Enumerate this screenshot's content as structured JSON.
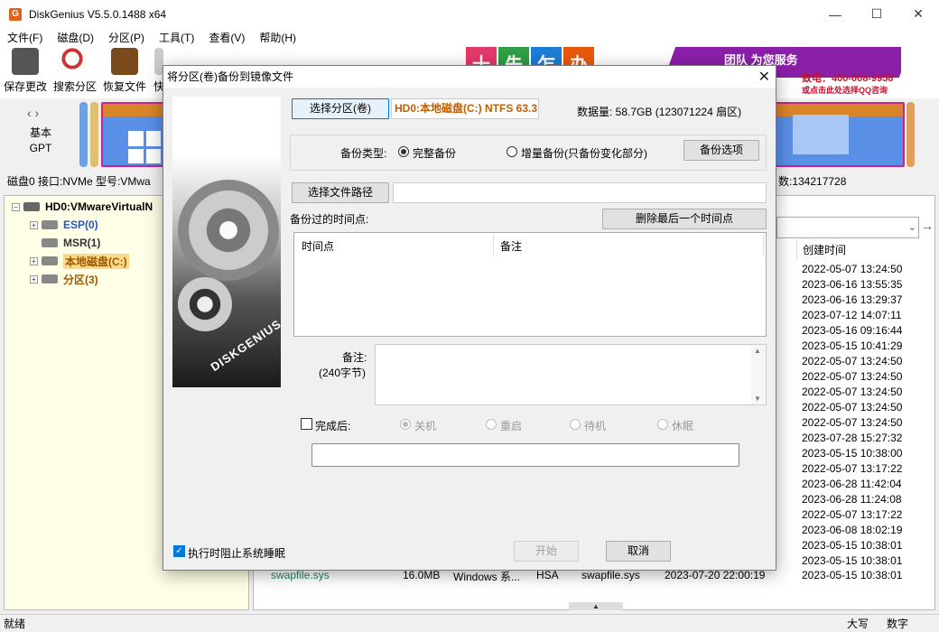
{
  "window": {
    "title": "DiskGenius V5.5.0.1488 x64",
    "logo": "G"
  },
  "menu": [
    "文件(F)",
    "磁盘(D)",
    "分区(P)",
    "工具(T)",
    "查看(V)",
    "帮助(H)"
  ],
  "toolbar": {
    "save": "保存更改",
    "search": "搜索分区",
    "recover": "恢复文件",
    "quick": "快"
  },
  "banner": {
    "tiles": [
      "十",
      "先",
      "乍",
      "办"
    ],
    "slogan": "团队 为您服务",
    "phone": "致电：400-008-9958",
    "qq": "或点击此处选择QQ咨询"
  },
  "disk": {
    "type": "基本",
    "scheme": "GPT",
    "info": "磁盘0 接口:NVMe  型号:VMwa",
    "info_tail": "数:134217728"
  },
  "tree": {
    "root": "HD0:VMwareVirtualN",
    "items": [
      "ESP(0)",
      "MSR(1)",
      "本地磁盘(C:)",
      "分区(3)"
    ]
  },
  "right": {
    "col_created": "创建时间",
    "timestamps": [
      "2022-05-07 13:24:50",
      "2023-06-16 13:55:35",
      "2023-06-16 13:29:37",
      "2023-07-12 14:07:11",
      "2023-05-16 09:16:44",
      "2023-05-15 10:41:29",
      "2022-05-07 13:24:50",
      "2022-05-07 13:24:50",
      "2022-05-07 13:24:50",
      "2022-05-07 13:24:50",
      "2022-05-07 13:24:50",
      "2023-07-28 15:27:32",
      "2023-05-15 10:38:00",
      "2022-05-07 13:17:22",
      "2023-06-28 11:42:04",
      "2023-06-28 11:24:08",
      "2022-05-07 13:17:22",
      "2023-06-08 18:02:19",
      "2023-05-15 10:38:01",
      "2023-05-15 10:38:01",
      "2023-05-15 10:38:01"
    ],
    "file": {
      "name": "swapfile.sys",
      "size": "16.0MB",
      "type": "Windows 系...",
      "attr": "HSA",
      "short": "swapfile.sys",
      "modified": "2023-07-20 22:00:19"
    }
  },
  "status": {
    "left": "就绪",
    "caps": "大写",
    "num": "数字"
  },
  "dialog": {
    "title": "将分区(卷)备份到镜像文件",
    "select_partition_btn": "选择分区(卷)",
    "partition_label": "HD0:本地磁盘(C:) NTFS 63.3",
    "data_amount": "数据量: 58.7GB (123071224 扇区)",
    "backup_type_label": "备份类型:",
    "backup_full": "完整备份",
    "backup_incremental": "增量备份(只备份变化部分)",
    "backup_options_btn": "备份选项",
    "select_path_btn": "选择文件路径",
    "path_value": "",
    "timepoints_label": "备份过的时间点:",
    "delete_last_btn": "删除最后一个时间点",
    "col_time": "时间点",
    "col_remark": "备注",
    "remark_label": "备注:",
    "remark_limit": "(240字节)",
    "remark_value": "",
    "after_label": "完成后:",
    "after_options": [
      "关机",
      "重启",
      "待机",
      "休眠"
    ],
    "prevent_sleep": "执行时阻止系统睡眠",
    "start_btn": "开始",
    "cancel_btn": "取消",
    "progress": 0
  }
}
